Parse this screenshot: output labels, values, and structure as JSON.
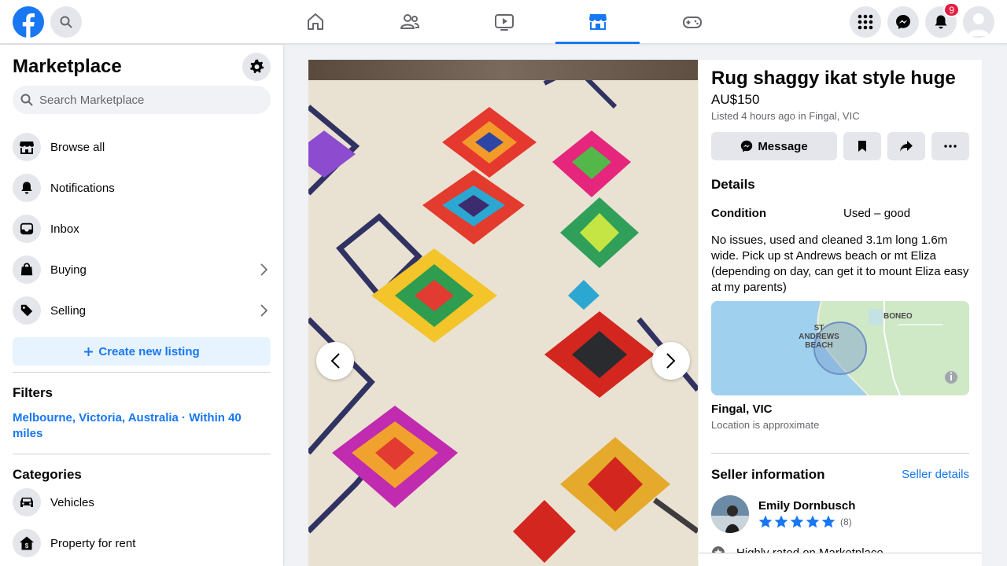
{
  "colors": {
    "accent": "#1877f2",
    "notification_badge": "#e41e3f",
    "grey_button": "#e4e6eb"
  },
  "top_nav": {
    "logo_icon": "facebook-logo-icon",
    "search_icon": "search-icon",
    "tabs": [
      {
        "name": "home",
        "icon": "home-icon",
        "active": false
      },
      {
        "name": "friends",
        "icon": "friends-icon",
        "active": false
      },
      {
        "name": "watch",
        "icon": "video-icon",
        "active": false
      },
      {
        "name": "marketplace",
        "icon": "storefront-icon",
        "active": true
      },
      {
        "name": "gaming",
        "icon": "gamepad-icon",
        "active": false
      }
    ],
    "right_icons": [
      "menu-grid-icon",
      "messenger-icon",
      "bell-icon",
      "account-avatar"
    ],
    "notification_count": "9"
  },
  "sidebar": {
    "title": "Marketplace",
    "search_placeholder": "Search Marketplace",
    "items": [
      {
        "label": "Browse all",
        "icon": "storefront-icon"
      },
      {
        "label": "Notifications",
        "icon": "bell-icon"
      },
      {
        "label": "Inbox",
        "icon": "inbox-icon"
      },
      {
        "label": "Buying",
        "icon": "shopping-bag-icon"
      },
      {
        "label": "Selling",
        "icon": "price-tag-icon"
      }
    ],
    "create_label": "Create new listing",
    "filters_heading": "Filters",
    "filter_location": "Melbourne, Victoria, Australia · Within 40 miles",
    "categories_heading": "Categories",
    "categories": [
      {
        "label": "Vehicles",
        "icon": "car-icon"
      },
      {
        "label": "Property for rent",
        "icon": "house-dollar-icon"
      }
    ]
  },
  "listing": {
    "title": "Rug shaggy ikat style huge",
    "price": "AU$150",
    "listed": "Listed 4 hours ago in Fingal, VIC",
    "message_label": "Message",
    "details_heading": "Details",
    "condition_label": "Condition",
    "condition_value": "Used – good",
    "description": "No issues, used and cleaned 3.1m long 1.6m wide. Pick up st Andrews beach or mt Eliza (depending on day, can get it to mount Eliza easy at my parents)",
    "map_labels": {
      "beach_line1": "ST",
      "beach_line2": "ANDREWS",
      "beach_line3": "BEACH",
      "boneo": "BONEO"
    },
    "location_name": "Fingal, VIC",
    "location_note": "Location is approximate",
    "seller_heading": "Seller information",
    "seller_details_link": "Seller details",
    "seller_name": "Emily Dornbusch",
    "seller_rating_stars": 5,
    "seller_rating_count": "(8)",
    "seller_badge": "Highly rated on Marketplace"
  }
}
